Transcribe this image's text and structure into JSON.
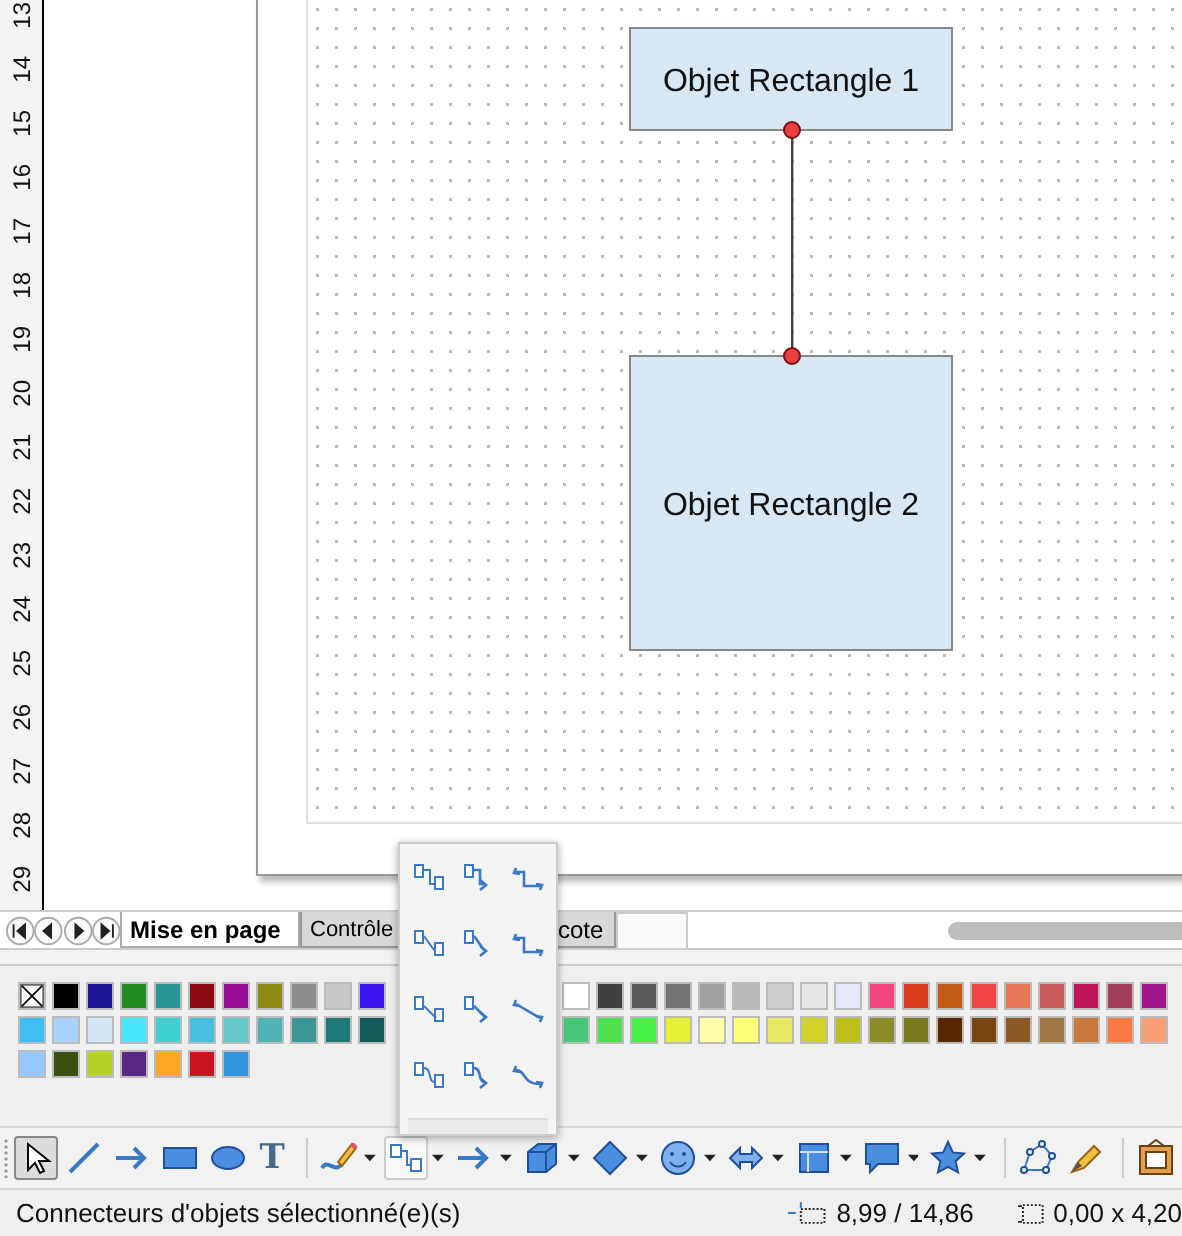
{
  "ruler": {
    "marks": [
      "13",
      "14",
      "15",
      "16",
      "17",
      "18",
      "19",
      "20",
      "21",
      "22",
      "23",
      "24",
      "25",
      "26",
      "27",
      "28",
      "29"
    ]
  },
  "canvas": {
    "shapes": [
      {
        "kind": "rectangle",
        "label": "Objet Rectangle 1"
      },
      {
        "kind": "rectangle",
        "label": "Objet Rectangle 2"
      }
    ],
    "connector": {
      "selected": true
    }
  },
  "sheet_tabs": [
    {
      "label": "Mise en page",
      "selected": true
    },
    {
      "label": "Contrôle",
      "selected": false
    },
    {
      "label": "cote",
      "selected": false
    }
  ],
  "palette": {
    "left_rows": [
      [
        {
          "kind": "none"
        },
        {
          "kind": "color",
          "color": "#000000"
        },
        {
          "kind": "color",
          "color": "#1e1496"
        },
        {
          "kind": "color",
          "color": "#1e8c1e"
        },
        {
          "kind": "color",
          "color": "#289696"
        },
        {
          "kind": "color",
          "color": "#8c0a14"
        },
        {
          "kind": "color",
          "color": "#960a96"
        },
        {
          "kind": "color",
          "color": "#8c8c14"
        },
        {
          "kind": "color",
          "color": "#8c8c8c"
        },
        {
          "kind": "color",
          "color": "#c8c8c8"
        },
        {
          "kind": "color",
          "color": "#3c14f0"
        }
      ],
      [
        {
          "kind": "color",
          "color": "#3cbef0"
        },
        {
          "kind": "color",
          "color": "#aad2ff"
        },
        {
          "kind": "color",
          "color": "#d2e6f5"
        },
        {
          "kind": "color",
          "color": "#46e6ff"
        },
        {
          "kind": "color",
          "color": "#3cd2d2"
        },
        {
          "kind": "color",
          "color": "#46bedc"
        },
        {
          "kind": "color",
          "color": "#64c8c8"
        },
        {
          "kind": "color",
          "color": "#50b4b4"
        },
        {
          "kind": "color",
          "color": "#3c9696"
        },
        {
          "kind": "color",
          "color": "#1e7878"
        },
        {
          "kind": "color",
          "color": "#145a5a"
        }
      ],
      [
        {
          "kind": "color",
          "color": "#96c8ff"
        },
        {
          "kind": "color",
          "color": "#3c5014"
        },
        {
          "kind": "color",
          "color": "#b4d228"
        },
        {
          "kind": "color",
          "color": "#5a2887"
        },
        {
          "kind": "color",
          "color": "#ffa528"
        },
        {
          "kind": "color",
          "color": "#c8141e"
        },
        {
          "kind": "color",
          "color": "#3296dc"
        }
      ]
    ],
    "right_rows": [
      [
        {
          "kind": "color",
          "color": "#ffffff"
        },
        {
          "kind": "color",
          "color": "#3f3f3f"
        },
        {
          "kind": "color",
          "color": "#5a5a5a"
        },
        {
          "kind": "color",
          "color": "#737373"
        },
        {
          "kind": "color",
          "color": "#a0a0a0"
        },
        {
          "kind": "color",
          "color": "#b9b9b9"
        },
        {
          "kind": "color",
          "color": "#cfcfcf"
        },
        {
          "kind": "color",
          "color": "#e6e6e6"
        },
        {
          "kind": "color",
          "color": "#e8e8fc"
        },
        {
          "kind": "color",
          "color": "#f0457e"
        },
        {
          "kind": "color",
          "color": "#dc3c1e"
        },
        {
          "kind": "color",
          "color": "#c05a14"
        },
        {
          "kind": "color",
          "color": "#f04646"
        },
        {
          "kind": "color",
          "color": "#e8785a"
        },
        {
          "kind": "color",
          "color": "#c85a5a"
        },
        {
          "kind": "color",
          "color": "#c0145a"
        },
        {
          "kind": "color",
          "color": "#a03c5a"
        },
        {
          "kind": "color",
          "color": "#a0148c"
        }
      ],
      [
        {
          "kind": "color",
          "color": "#46c878"
        },
        {
          "kind": "color",
          "color": "#50e050"
        },
        {
          "kind": "color",
          "color": "#46f046"
        },
        {
          "kind": "color",
          "color": "#e6f032"
        },
        {
          "kind": "color",
          "color": "#ffffaa"
        },
        {
          "kind": "color",
          "color": "#ffff78"
        },
        {
          "kind": "color",
          "color": "#e8e864"
        },
        {
          "kind": "color",
          "color": "#d2d228"
        },
        {
          "kind": "color",
          "color": "#bebe1e"
        },
        {
          "kind": "color",
          "color": "#8c8c28"
        },
        {
          "kind": "color",
          "color": "#78781e"
        },
        {
          "kind": "color",
          "color": "#5a2800"
        },
        {
          "kind": "color",
          "color": "#784614"
        },
        {
          "kind": "color",
          "color": "#8c5a28"
        },
        {
          "kind": "color",
          "color": "#a07846"
        },
        {
          "kind": "color",
          "color": "#c8783c"
        },
        {
          "kind": "color",
          "color": "#fa7846"
        },
        {
          "kind": "color",
          "color": "#faa078"
        }
      ]
    ]
  },
  "connector_menu": {
    "open": true
  },
  "toolbar": [
    {
      "kind": "pointer",
      "selected": true,
      "dropdown": false
    },
    {
      "kind": "line",
      "selected": false,
      "dropdown": false
    },
    {
      "kind": "arrow",
      "selected": false,
      "dropdown": false
    },
    {
      "kind": "rect",
      "selected": false,
      "dropdown": false
    },
    {
      "kind": "ellipse",
      "selected": false,
      "dropdown": false
    },
    {
      "kind": "text",
      "label": "T",
      "selected": false,
      "dropdown": false
    },
    {
      "kind": "separator"
    },
    {
      "kind": "curve",
      "selected": false,
      "dropdown": true
    },
    {
      "kind": "connector",
      "selected": false,
      "dropdown": true
    },
    {
      "kind": "arrow",
      "selected": false,
      "dropdown": true
    },
    {
      "kind": "cube",
      "selected": false,
      "dropdown": true
    },
    {
      "kind": "diamond",
      "selected": false,
      "dropdown": true
    },
    {
      "kind": "smiley",
      "selected": false,
      "dropdown": true
    },
    {
      "kind": "double-arrow",
      "selected": false,
      "dropdown": true
    },
    {
      "kind": "flowchart",
      "selected": false,
      "dropdown": true
    },
    {
      "kind": "callout",
      "selected": false,
      "dropdown": true
    },
    {
      "kind": "star",
      "selected": false,
      "dropdown": true
    },
    {
      "kind": "separator"
    },
    {
      "kind": "points",
      "selected": false,
      "dropdown": false
    },
    {
      "kind": "glue",
      "selected": false,
      "dropdown": false
    },
    {
      "kind": "separator"
    },
    {
      "kind": "fontwork",
      "selected": false,
      "dropdown": false
    }
  ],
  "status_bar": {
    "message": "Connecteurs d'objets sélectionné(e)(s)",
    "position": "8,99 / 14,86",
    "size": "0,00 x 4,20"
  }
}
